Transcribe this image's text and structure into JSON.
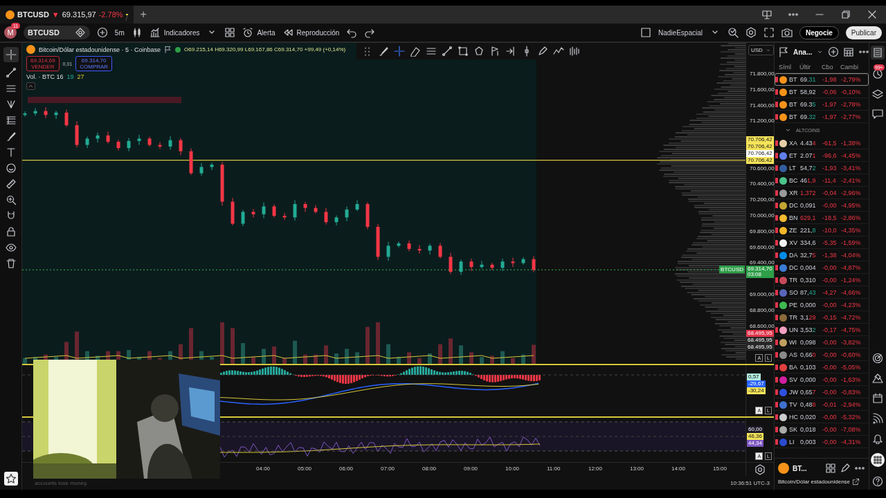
{
  "tab": {
    "symbol": "BTCUSD",
    "arrow": "▼",
    "price": "69.315,97",
    "change": "-2.78%",
    "separator": "/",
    "new_tab": "+"
  },
  "toolbar": {
    "avatar": "M",
    "badge": "11",
    "symbol": "BTCUSD",
    "interval": "5m",
    "indicators": "Indicadores",
    "alert": "Alerta",
    "replay": "Reproducción",
    "layout": "NadieEspacial",
    "trade": "Negocie",
    "publish": "Publicar"
  },
  "chart": {
    "title": "Bitcoin/Dólar estadounidense · 5 · Coinbase",
    "ohlc": "O69.215,14 H69.320,99 L69.167,86 C69.314,70 +99,49 (+0,14%)",
    "sell": {
      "price": "69.314,69",
      "label": "VENDER"
    },
    "spread": "0,01",
    "buy": {
      "price": "69.314,70",
      "label": "COMPRAR"
    },
    "volume": {
      "label": "Vol. · BTC 16",
      "up": "19",
      "down": "27"
    },
    "currency": "USD",
    "price_tags": [
      {
        "labels": [
          {
            "text": "70.706,42",
            "color": "#f5e35a"
          },
          {
            "text": "70.706,42",
            "color": "#f5e35a"
          },
          {
            "text": "70.706,42",
            "color": "#ffffff"
          },
          {
            "text": "70.706,42",
            "color": "#f5e35a"
          }
        ]
      },
      {
        "symbol": "BTCUSD",
        "labels": [
          {
            "text": "69.314,70",
            "sub": "03:08",
            "color": "#2e9e48"
          }
        ]
      },
      {
        "labels": [
          {
            "text": "68.495,95",
            "color": "#e0344a"
          },
          {
            "text": "68.495,95",
            "color": "#262626"
          },
          {
            "text": "68.495,95",
            "color": "#262626"
          }
        ]
      }
    ],
    "scale_buttons": [
      {
        "label": "A",
        "selected": false
      },
      {
        "label": "L",
        "selected": false
      }
    ],
    "price_ticks": [
      "71.800,00",
      "71.600,00",
      "71.400,00",
      "71.200,00",
      "70.600,00",
      "70.400,00",
      "70.200,00",
      "70.000,00",
      "69.800,00",
      "69.600,00",
      "69.400,00",
      "69.000,00",
      "68.800,00",
      "68.600,00"
    ],
    "time_ticks": [
      "04:00",
      "05:00",
      "06:00",
      "07:00",
      "08:00",
      "09:00",
      "10:00",
      "11:00",
      "12:00",
      "13:00",
      "14:00",
      "15:00"
    ]
  },
  "macd": {
    "labels": [
      {
        "text": "0,57",
        "color": "#b2ebdf"
      },
      {
        "text": "-29,67",
        "color": "#2962ff"
      },
      {
        "text": "-30,24",
        "color": "#f5e35a"
      }
    ],
    "scale_buttons": [
      {
        "label": "A",
        "selected": true
      },
      {
        "label": "L",
        "selected": false
      }
    ]
  },
  "rsi": {
    "labels": [
      {
        "text": "60,00",
        "color": "#1c1828"
      },
      {
        "text": "46,36",
        "color": "#f5e35a"
      },
      {
        "text": "44,34",
        "color": "#7e57c2"
      }
    ],
    "scale_buttons": [
      {
        "label": "A",
        "selected": true
      },
      {
        "label": "L",
        "selected": false
      }
    ]
  },
  "status": {
    "disclaimer": "accounts lose money.",
    "clock": "10:36:51 UTC-3"
  },
  "watchlist": {
    "title": "Ana...",
    "columns": [
      "Síml",
      "Últir",
      "Cbo",
      "Cambi"
    ],
    "sections": [
      {
        "rows": [
          {
            "symbol": "BT",
            "last": "69.",
            "tick": "31",
            "up": true,
            "change": "-1,98",
            "percent": "-2,79%",
            "color": "#f7931a",
            "selected": true
          },
          {
            "symbol": "BT",
            "last": "58,92",
            "change": "-0,06",
            "percent": "-0,10%",
            "color": "#f7931a",
            "selected": false
          },
          {
            "symbol": "BT",
            "last": "69.3",
            "tick": "5",
            "up": true,
            "change": "-1,97",
            "percent": "-2,78%",
            "color": "#f7931a",
            "selected": false
          },
          {
            "symbol": "BT",
            "last": "69.",
            "tick": "32",
            "up": true,
            "change": "-1,97",
            "percent": "-2,77%",
            "color": "#f7931a",
            "selected": false
          }
        ]
      },
      {
        "title": "ALTCOINS",
        "expanded": true,
        "rows": [
          {
            "symbol": "XA",
            "last": "4.43",
            "tick": "4",
            "up": false,
            "change": "-61,5",
            "percent": "-1,38%",
            "color": "#e6cfa8",
            "selected": false
          },
          {
            "symbol": "ET",
            "last": "2.07",
            "tick": "1",
            "up": false,
            "change": "-96,6",
            "percent": "-4,45%",
            "color": "#627eea",
            "selected": false
          },
          {
            "symbol": "LT",
            "last": "54,7",
            "tick": "2",
            "up": true,
            "change": "-1,93",
            "percent": "-3,41%",
            "color": "#345d9d",
            "selected": false
          },
          {
            "symbol": "BC",
            "last": "46",
            "tick": "1,9",
            "up": false,
            "change": "-11,4",
            "percent": "-2,41%",
            "color": "#4cc38a",
            "selected": false
          },
          {
            "symbol": "XR",
            "tick": "1,372",
            "up": false,
            "change": "-0,04",
            "percent": "-2,96%",
            "color": "#9a9a9a",
            "selected": false
          },
          {
            "symbol": "DC",
            "last": "0,091",
            "change": "-0,00",
            "percent": "-4,95%",
            "color": "#c2a633",
            "selected": false
          },
          {
            "symbol": "BN",
            "tick": "629,1",
            "up": false,
            "change": "-18,5",
            "percent": "-2,86%",
            "color": "#f3ba2f",
            "selected": false
          },
          {
            "symbol": "ZE",
            "last": "221,",
            "tick": "8",
            "up": true,
            "change": "-10,0",
            "percent": "-4,35%",
            "color": "#f4b728",
            "selected": false
          },
          {
            "symbol": "XV",
            "last": "334,6",
            "change": "-5,35",
            "percent": "-1,59%",
            "color": "#f2f2f2",
            "selected": false
          },
          {
            "symbol": "DA",
            "last": "32,7",
            "tick": "5",
            "up": false,
            "change": "-1,38",
            "percent": "-4,04%",
            "color": "#008ce7",
            "selected": false
          },
          {
            "symbol": "DC",
            "last": "0,004",
            "change": "-0,00",
            "percent": "-4,87%",
            "color": "#3a7bd5",
            "selected": false
          },
          {
            "symbol": "TR",
            "last": "0,310",
            "change": "-0,00",
            "percent": "-1,24%",
            "color": "#c74a5a",
            "selected": false
          },
          {
            "symbol": "SO",
            "last": "87,",
            "tick": "43",
            "up": true,
            "change": "-4,27",
            "percent": "-4,66%",
            "color": "#5a66b8",
            "selected": false
          },
          {
            "symbol": "PE",
            "last": "0,000",
            "change": "-0,00",
            "percent": "-4,23%",
            "color": "#3fb950",
            "selected": false
          },
          {
            "symbol": "TR",
            "last": "3,1",
            "tick": "29",
            "up": false,
            "change": "-0,15",
            "percent": "-4,72%",
            "color": "#8a6a3a",
            "selected": false
          },
          {
            "symbol": "UN",
            "last": "3,53",
            "tick": "2",
            "up": true,
            "change": "-0,17",
            "percent": "-4,75%",
            "color": "#f0a0c0",
            "selected": false
          },
          {
            "symbol": "WI",
            "last": "0,098",
            "change": "-0,00",
            "percent": "-3,82%",
            "color": "#c0a060",
            "selected": false
          },
          {
            "symbol": "AS",
            "last": "0,66",
            "tick": "0",
            "up": false,
            "change": "-0,00",
            "percent": "-0,60%",
            "color": "#8a8a8a",
            "selected": false
          },
          {
            "symbol": "BA",
            "last": "0,103",
            "change": "-0,00",
            "percent": "-5,05%",
            "color": "#e04040",
            "selected": false
          },
          {
            "symbol": "SV",
            "last": "0,000",
            "change": "-0,00",
            "percent": "-1,63%",
            "color": "#d020a0",
            "selected": false
          },
          {
            "symbol": "JW",
            "last": "0,65",
            "tick": "7",
            "up": false,
            "change": "-0,00",
            "percent": "-0,83%",
            "color": "#3050e0",
            "selected": false
          },
          {
            "symbol": "TV",
            "last": "0,48",
            "tick": "8",
            "up": false,
            "change": "-0,01",
            "percent": "-2,94%",
            "color": "#4070d0",
            "selected": false
          },
          {
            "symbol": "HC",
            "last": "0,020",
            "change": "-0,00",
            "percent": "-5,32%",
            "color": "#cccccc",
            "selected": false
          },
          {
            "symbol": "SK",
            "last": "0,018",
            "change": "-0,00",
            "percent": "-7,08%",
            "color": "#aaaaaa",
            "selected": false
          },
          {
            "symbol": "LI",
            "last": "0,003",
            "change": "-0,00",
            "percent": "-4,31%",
            "color": "#2a4bd0",
            "selected": false
          }
        ]
      }
    ],
    "footer": {
      "symbol": "BT...",
      "name": "Bitcoin/Dólar estadounidense"
    }
  },
  "right_panel": {
    "badge": "99+"
  }
}
